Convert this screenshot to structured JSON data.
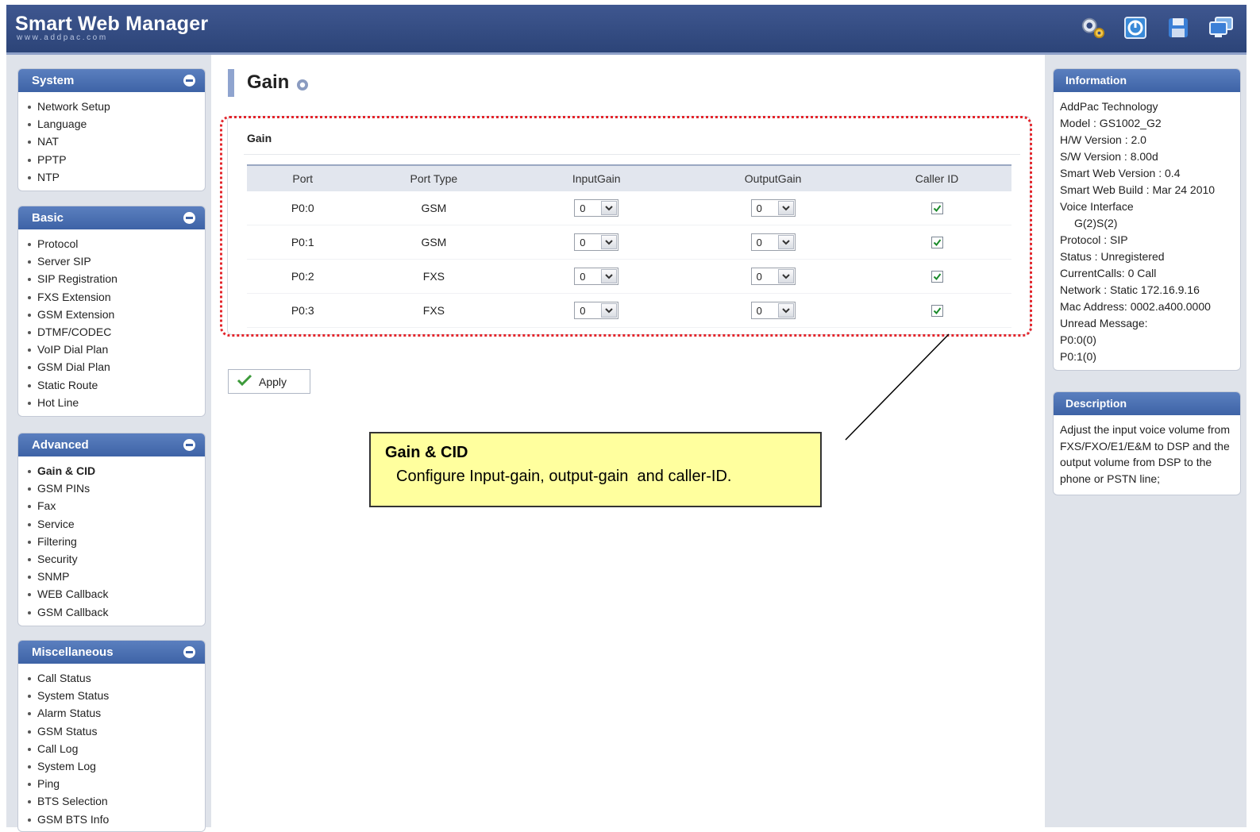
{
  "app": {
    "title": "Smart Web Manager",
    "subtitle": "www.addpac.com"
  },
  "header_icons": [
    "gear-icon",
    "power-icon",
    "save-icon",
    "monitor-icon"
  ],
  "colors": {
    "header": "#33497f",
    "sidebar_head": "#4a6eb0",
    "callout_bg": "#ffff9e",
    "highlight_dotted": "#e3262c"
  },
  "sidebar": {
    "system": {
      "title": "System",
      "items": [
        "Network Setup",
        "Language",
        "NAT",
        "PPTP",
        "NTP"
      ]
    },
    "basic": {
      "title": "Basic",
      "items": [
        "Protocol",
        "Server SIP",
        "SIP Registration",
        "FXS Extension",
        "GSM Extension",
        "DTMF/CODEC",
        "VoIP Dial Plan",
        "GSM Dial Plan",
        "Static Route",
        "Hot Line"
      ]
    },
    "advanced": {
      "title": "Advanced",
      "active": "Gain & CID",
      "items": [
        "Gain & CID",
        "GSM PINs",
        "Fax",
        "Service",
        "Filtering",
        "Security",
        "SNMP",
        "WEB Callback",
        "GSM Callback"
      ]
    },
    "misc": {
      "title": "Miscellaneous",
      "items": [
        "Call Status",
        "System Status",
        "Alarm Status",
        "GSM Status",
        "Call Log",
        "System Log",
        "Ping",
        "BTS Selection",
        "GSM BTS Info"
      ]
    }
  },
  "main": {
    "title": "Gain",
    "panel_title": "Gain",
    "columns": [
      "Port",
      "Port Type",
      "InputGain",
      "OutputGain",
      "Caller ID"
    ],
    "rows": [
      {
        "port": "P0:0",
        "type": "GSM",
        "input_gain": "0",
        "output_gain": "0",
        "caller_id": true
      },
      {
        "port": "P0:1",
        "type": "GSM",
        "input_gain": "0",
        "output_gain": "0",
        "caller_id": true
      },
      {
        "port": "P0:2",
        "type": "FXS",
        "input_gain": "0",
        "output_gain": "0",
        "caller_id": true
      },
      {
        "port": "P0:3",
        "type": "FXS",
        "input_gain": "0",
        "output_gain": "0",
        "caller_id": true
      }
    ],
    "apply_label": "Apply"
  },
  "callout": {
    "title": "Gain & CID",
    "text": "Configure Input-gain, output-gain  and caller-ID."
  },
  "info": {
    "title": "Information",
    "lines": [
      "AddPac Technology",
      "Model : GS1002_G2",
      "H/W Version : 2.0",
      "S/W Version : 8.00d",
      "Smart Web Version : 0.4",
      "Smart Web Build : Mar 24 2010",
      "Voice Interface",
      "G(2)S(2)",
      "Protocol : SIP",
      "Status : Unregistered",
      "CurrentCalls: 0 Call",
      "Network : Static 172.16.9.16",
      "Mac Address: 0002.a400.0000",
      "Unread Message:",
      "P0:0(0)",
      "P0:1(0)"
    ]
  },
  "description": {
    "title": "Description",
    "text": "Adjust the input voice volume from FXS/FXO/E1/E&M to DSP and the output volume from DSP to the phone or PSTN line;"
  }
}
